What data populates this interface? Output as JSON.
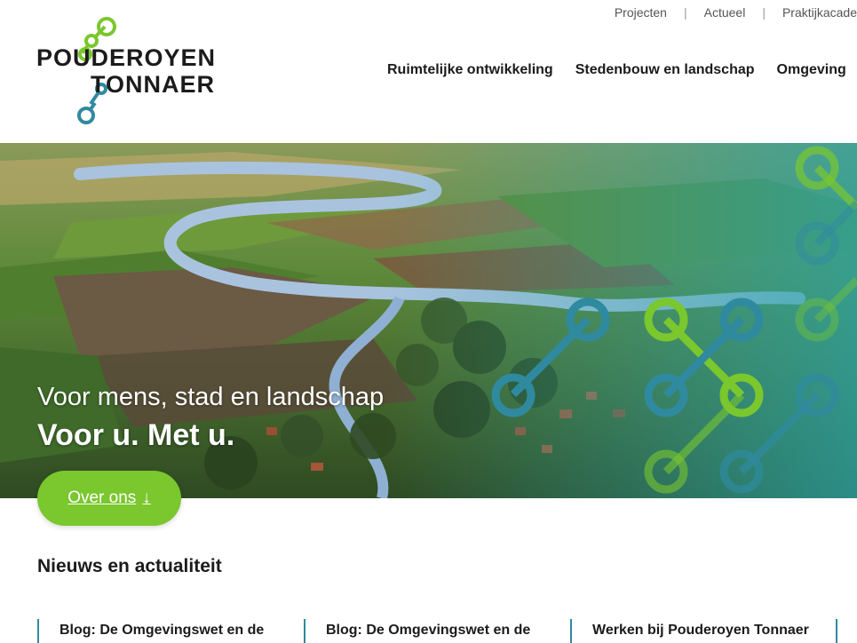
{
  "brand": {
    "name_line1": "POUDEROYEN",
    "name_line2": "TONNAER",
    "colors": {
      "green": "#7ac72e",
      "teal": "#2f8aa0"
    }
  },
  "top_nav": [
    "Projecten",
    "Actueel",
    "Praktijkacade"
  ],
  "main_nav": [
    "Ruimtelijke ontwikkeling",
    "Stedenbouw en landschap",
    "Omgeving"
  ],
  "hero": {
    "subtitle": "Voor mens, stad en landschap",
    "title": "Voor u. Met u."
  },
  "cta": {
    "label": "Over ons",
    "icon": "arrow-down-icon"
  },
  "news": {
    "heading": "Nieuws en actualiteit",
    "items": [
      "Blog: De Omgevingswet en de",
      "Blog: De Omgevingswet en de",
      "Werken bij Pouderoyen Tonnaer"
    ]
  }
}
